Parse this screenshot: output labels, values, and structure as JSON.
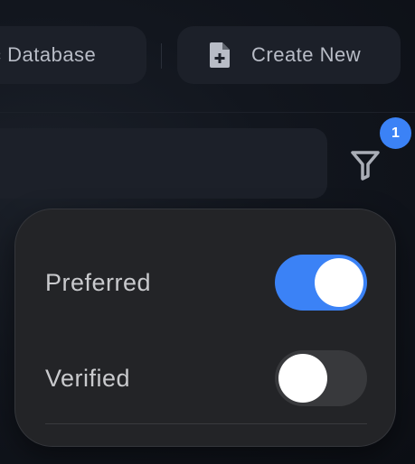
{
  "toolbar": {
    "database_label": "c Database",
    "create_new_label": "Create New",
    "create_new_icon": "file-plus-icon"
  },
  "filter": {
    "icon": "filter-icon",
    "active_count": "1"
  },
  "filter_panel": {
    "items": [
      {
        "label": "Preferred",
        "enabled": true
      },
      {
        "label": "Verified",
        "enabled": false
      }
    ]
  },
  "colors": {
    "accent": "#3b82f6",
    "toggle_off": "#38393c",
    "panel_bg": "#232427",
    "button_bg": "#1c2029"
  }
}
